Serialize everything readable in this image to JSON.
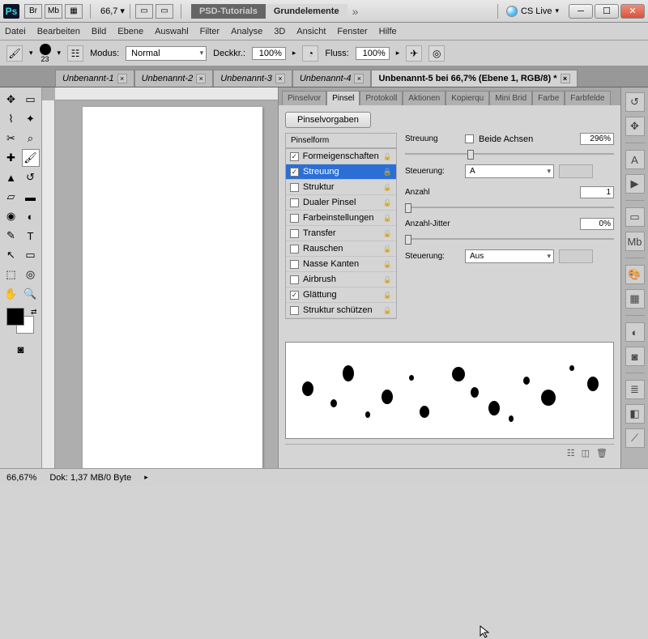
{
  "titlebar": {
    "br": "Br",
    "mb": "Mb",
    "zoom": "66,7",
    "tab_dark": "PSD-Tutorials",
    "tab_light": "Grundelemente",
    "cslive": "CS Live"
  },
  "menu": [
    "Datei",
    "Bearbeiten",
    "Bild",
    "Ebene",
    "Auswahl",
    "Filter",
    "Analyse",
    "3D",
    "Ansicht",
    "Fenster",
    "Hilfe"
  ],
  "opt": {
    "brush_size": "23",
    "modus_label": "Modus:",
    "modus_value": "Normal",
    "deckkr_label": "Deckkr.:",
    "deckkr_value": "100%",
    "fluss_label": "Fluss:",
    "fluss_value": "100%"
  },
  "docs": {
    "tabs": [
      "Unbenannt-1",
      "Unbenannt-2",
      "Unbenannt-3",
      "Unbenannt-4"
    ],
    "active": "Unbenannt-5 bei 66,7% (Ebene 1, RGB/8) *"
  },
  "panel": {
    "tabs": [
      "Pinselvor",
      "Pinsel",
      "Protokoll",
      "Aktionen",
      "Kopierqu",
      "Mini Brid",
      "Farbe",
      "Farbfelde"
    ],
    "preset_btn": "Pinselvorgaben",
    "list_header": "Pinselform",
    "items": [
      {
        "label": "Formeigenschaften",
        "checked": true,
        "selected": false
      },
      {
        "label": "Streuung",
        "checked": true,
        "selected": true
      },
      {
        "label": "Struktur",
        "checked": false,
        "selected": false
      },
      {
        "label": "Dualer Pinsel",
        "checked": false,
        "selected": false
      },
      {
        "label": "Farbeinstellungen",
        "checked": false,
        "selected": false
      },
      {
        "label": "Transfer",
        "checked": false,
        "selected": false
      },
      {
        "label": "Rauschen",
        "checked": false,
        "selected": false
      },
      {
        "label": "Nasse Kanten",
        "checked": false,
        "selected": false
      },
      {
        "label": "Airbrush",
        "checked": false,
        "selected": false
      },
      {
        "label": "Glättung",
        "checked": true,
        "selected": false
      },
      {
        "label": "Struktur schützen",
        "checked": false,
        "selected": false
      }
    ],
    "scatter": {
      "streuung_label": "Streuung",
      "beide_achsen": "Beide Achsen",
      "streuung_value": "296%",
      "steuerung_label": "Steuerung:",
      "steuerung1_value": "A",
      "anzahl_label": "Anzahl",
      "anzahl_value": "1",
      "jitter_label": "Anzahl-Jitter",
      "jitter_value": "0%",
      "steuerung2_value": "Aus"
    }
  },
  "status": {
    "zoom": "66,67%",
    "dok": "Dok: 1,37 MB/0 Byte"
  }
}
